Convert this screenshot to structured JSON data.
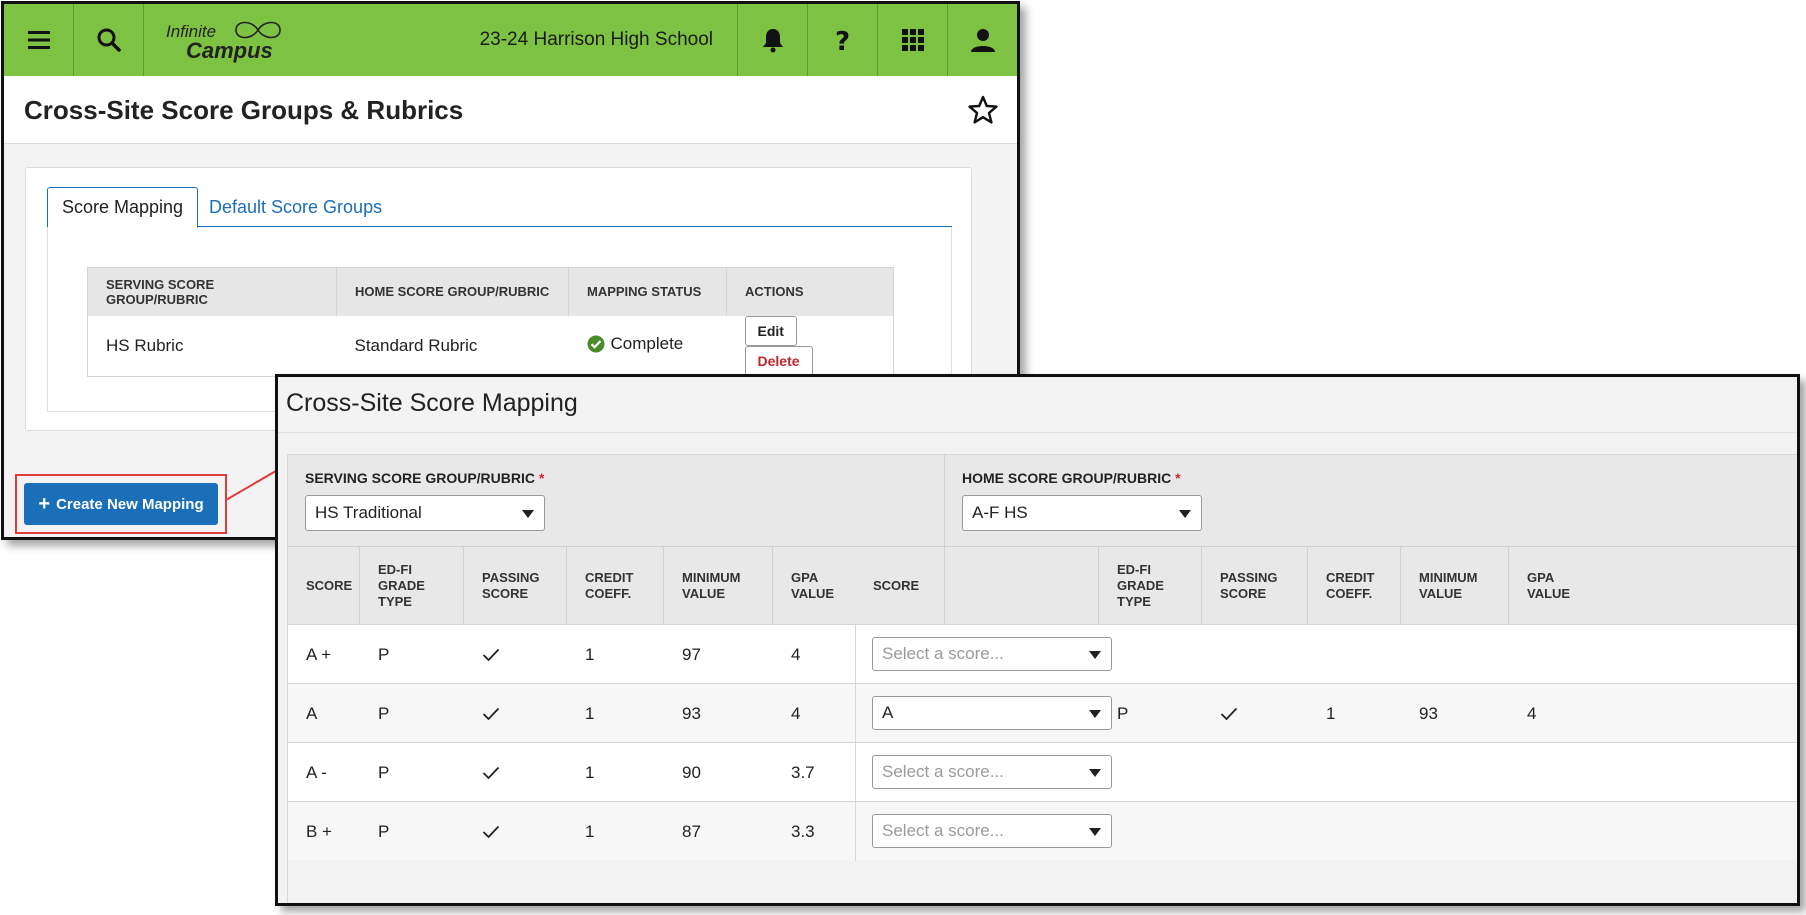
{
  "topbar": {
    "logo_line1": "Infinite",
    "logo_line2": "Campus",
    "school": "23-24 Harrison High School",
    "icons": [
      "menu-icon",
      "search-icon",
      "bell-icon",
      "help-icon",
      "apps-grid-icon",
      "user-icon"
    ]
  },
  "page": {
    "title": "Cross-Site Score Groups & Rubrics"
  },
  "tabs": [
    {
      "label": "Score Mapping",
      "active": true
    },
    {
      "label": "Default Score Groups",
      "active": false
    }
  ],
  "mapping_table": {
    "headers": [
      "SERVING SCORE GROUP/RUBRIC",
      "HOME SCORE GROUP/RUBRIC",
      "MAPPING STATUS",
      "ACTIONS"
    ],
    "rows": [
      {
        "serving": "HS Rubric",
        "home": "Standard Rubric",
        "status": "Complete",
        "edit": "Edit",
        "delete": "Delete"
      }
    ]
  },
  "create_button": {
    "plus": "+",
    "label": "Create New Mapping"
  },
  "colors": {
    "topbar": "#7dc242",
    "primary": "#1b6fb9",
    "danger": "#c0262b",
    "success": "#4a8c2a",
    "highlight": "#e23b3b"
  },
  "mapping_editor": {
    "title": "Cross-Site Score Mapping",
    "serving": {
      "label": "SERVING SCORE GROUP/RUBRIC",
      "required": "*",
      "value": "HS Traditional"
    },
    "home": {
      "label": "HOME SCORE GROUP/RUBRIC",
      "required": "*",
      "value": "A-F HS"
    },
    "serving_columns": [
      [
        "SCORE"
      ],
      [
        "ED-FI",
        "GRADE",
        "TYPE"
      ],
      [
        "PASSING",
        "SCORE"
      ],
      [
        "CREDIT",
        "COEFF."
      ],
      [
        "MINIMUM",
        "VALUE"
      ],
      [
        "GPA",
        "VALUE"
      ]
    ],
    "home_columns": [
      [
        "SCORE"
      ],
      [
        "ED-FI",
        "GRADE",
        "TYPE"
      ],
      [
        "PASSING",
        "SCORE"
      ],
      [
        "CREDIT",
        "COEFF."
      ],
      [
        "MINIMUM",
        "VALUE"
      ],
      [
        "GPA",
        "VALUE"
      ]
    ],
    "placeholder": "Select a score...",
    "rows": [
      {
        "score": "A +",
        "type": "P",
        "passing": true,
        "credit": "1",
        "min": "97",
        "gpa": "4",
        "home_score": "",
        "home_type": "",
        "home_passing": false,
        "home_credit": "",
        "home_min": "",
        "home_gpa": ""
      },
      {
        "score": "A",
        "type": "P",
        "passing": true,
        "credit": "1",
        "min": "93",
        "gpa": "4",
        "home_score": "A",
        "home_type": "P",
        "home_passing": true,
        "home_credit": "1",
        "home_min": "93",
        "home_gpa": "4"
      },
      {
        "score": "A -",
        "type": "P",
        "passing": true,
        "credit": "1",
        "min": "90",
        "gpa": "3.7",
        "home_score": "",
        "home_type": "",
        "home_passing": false,
        "home_credit": "",
        "home_min": "",
        "home_gpa": ""
      },
      {
        "score": "B +",
        "type": "P",
        "passing": true,
        "credit": "1",
        "min": "87",
        "gpa": "3.3",
        "home_score": "",
        "home_type": "",
        "home_passing": false,
        "home_credit": "",
        "home_min": "",
        "home_gpa": ""
      }
    ]
  }
}
